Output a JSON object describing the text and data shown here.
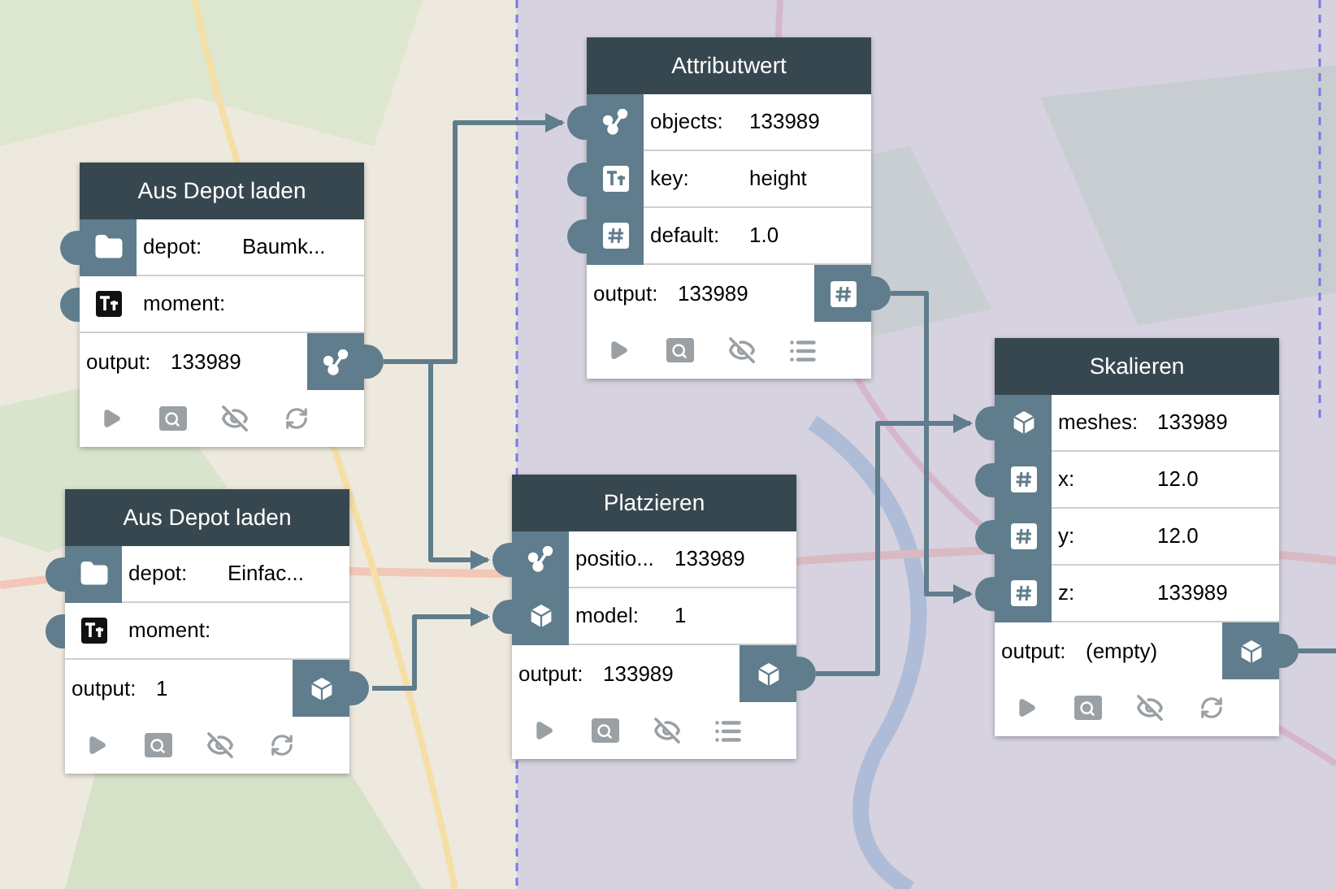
{
  "nodes": [
    {
      "title": "Aus Depot laden",
      "inputs": [
        {
          "kind": "folder",
          "label": "depot:",
          "value": "Baumk...",
          "active": true
        },
        {
          "kind": "text",
          "label": "moment:",
          "active": false
        }
      ],
      "output": {
        "label": "output:",
        "value": "133989",
        "kind": "graph"
      },
      "tools": [
        {
          "kind": "run"
        },
        {
          "kind": "inspect"
        },
        {
          "kind": "hide"
        },
        {
          "kind": "refresh"
        }
      ]
    },
    {
      "title": "Aus Depot laden",
      "inputs": [
        {
          "kind": "folder",
          "label": "depot:",
          "value": "Einfac...",
          "active": true
        },
        {
          "kind": "text",
          "label": "moment:",
          "active": false
        }
      ],
      "output": {
        "label": "output:",
        "value": "1",
        "kind": "cube"
      },
      "tools": [
        {
          "kind": "run"
        },
        {
          "kind": "inspect"
        },
        {
          "kind": "hide"
        },
        {
          "kind": "refresh"
        }
      ]
    },
    {
      "title": "Attributwert",
      "inputs": [
        {
          "kind": "graph",
          "label": "objects:",
          "value": "133989",
          "active": true
        },
        {
          "kind": "text",
          "label": "key:",
          "value": "height",
          "active": true
        },
        {
          "kind": "hash",
          "label": "default:",
          "value": "1.0",
          "active": true
        }
      ],
      "output": {
        "label": "output:",
        "value": "133989",
        "kind": "hash"
      },
      "tools": [
        {
          "kind": "run"
        },
        {
          "kind": "inspect"
        },
        {
          "kind": "hide"
        },
        {
          "kind": "list"
        }
      ]
    },
    {
      "title": "Platzieren",
      "inputs": [
        {
          "kind": "graph",
          "label": "positio...",
          "value": "133989",
          "active": true
        },
        {
          "kind": "cube",
          "label": "model:",
          "value": "1",
          "active": true
        }
      ],
      "output": {
        "label": "output:",
        "value": "133989",
        "kind": "cube"
      },
      "tools": [
        {
          "kind": "run"
        },
        {
          "kind": "inspect"
        },
        {
          "kind": "hide"
        },
        {
          "kind": "list"
        }
      ]
    },
    {
      "title": "Skalieren",
      "inputs": [
        {
          "kind": "cube",
          "label": "meshes:",
          "value": "133989",
          "active": true
        },
        {
          "kind": "hash",
          "label": "x:",
          "value": "12.0",
          "active": true
        },
        {
          "kind": "hash",
          "label": "y:",
          "value": "12.0",
          "active": true
        },
        {
          "kind": "hash",
          "label": "z:",
          "value": "133989",
          "active": true
        }
      ],
      "output": {
        "label": "output:",
        "value": "(empty)",
        "kind": "cube"
      },
      "tools": [
        {
          "kind": "run"
        },
        {
          "kind": "inspect"
        },
        {
          "kind": "hide"
        },
        {
          "kind": "refresh"
        }
      ]
    }
  ]
}
